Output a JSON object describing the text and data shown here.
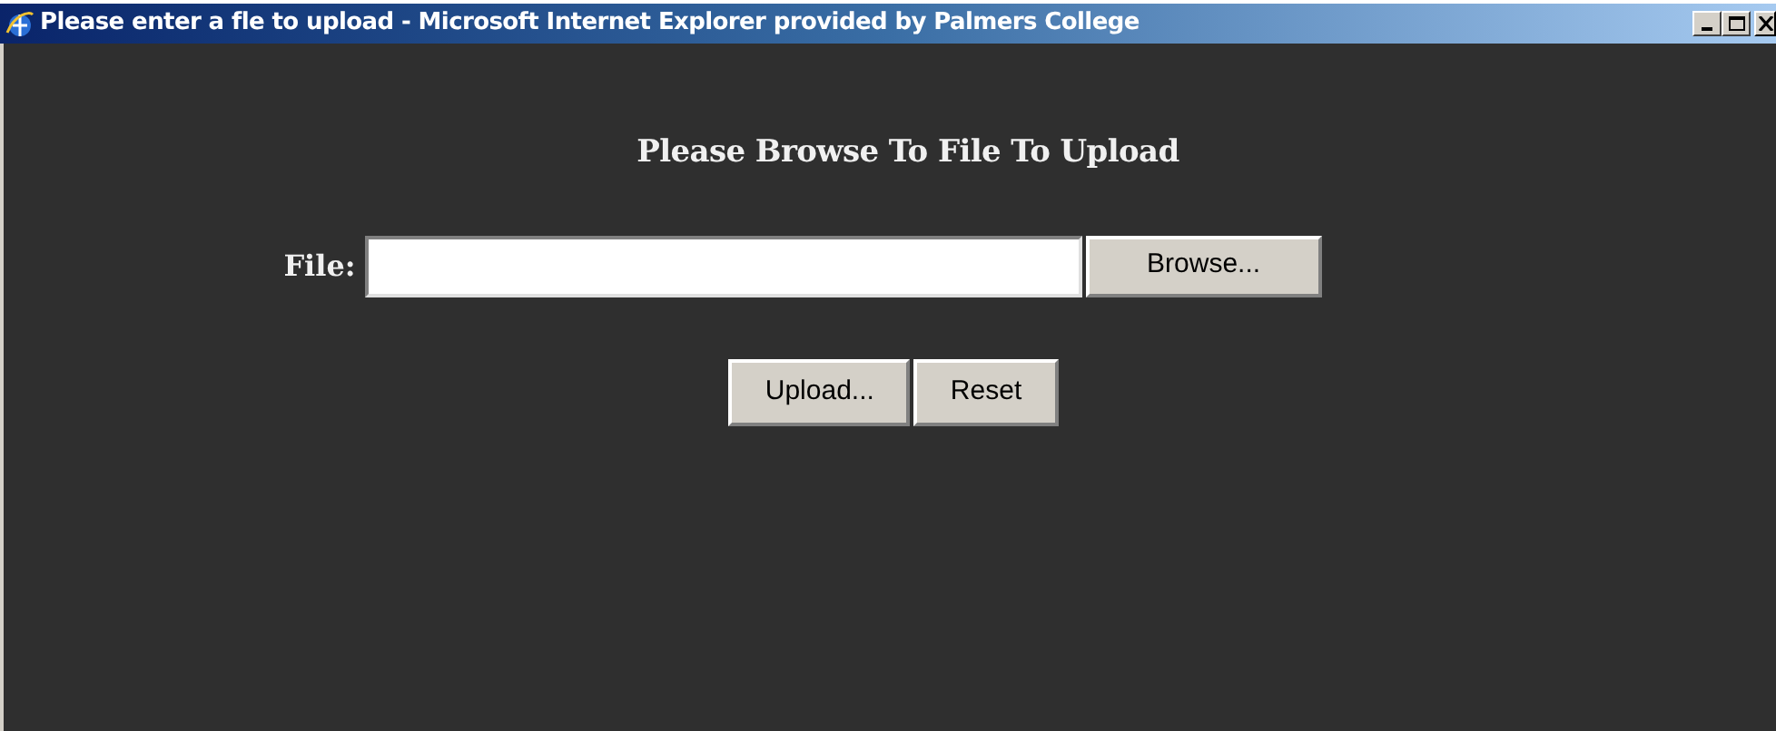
{
  "window": {
    "title": "Please enter a fle to upload - Microsoft Internet Explorer provided by Palmers College"
  },
  "form": {
    "heading": "Please Browse To File To Upload",
    "file_label": "File:",
    "browse_button": "Browse...",
    "buttons": [
      "Upload...",
      "Reset"
    ]
  }
}
